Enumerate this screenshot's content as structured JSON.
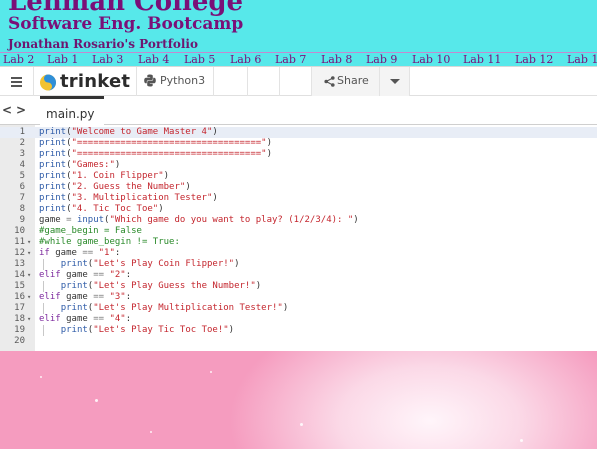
{
  "header": {
    "college": "Lehman College",
    "course": "Software Eng. Bootcamp",
    "portfolio": "Jonathan Rosario's Portfolio"
  },
  "nav": {
    "links": [
      "Lab 2",
      "Lab 1",
      "Lab 3",
      "Lab 4",
      "Lab 5",
      "Lab 6",
      "Lab 7",
      "Lab 8",
      "Lab 9",
      "Lab 10",
      "Lab 11",
      "Lab 12",
      "Lab 1"
    ]
  },
  "trinket": {
    "brand": "trinket",
    "language": "Python3",
    "share_label": "Share",
    "file_tab": "main.py",
    "nav_prev": "<",
    "nav_next": ">"
  },
  "code": {
    "lines": [
      "print(\"Welcome to Game Master 4\")",
      "print(\"==================================\")",
      "print(\"==================================\")",
      "print(\"Games:\")",
      "print(\"1. Coin Flipper\")",
      "print(\"2. Guess the Number\")",
      "print(\"3. Multiplication Tester\")",
      "print(\"4. Tic Toc Toe\")",
      "game = input(\"Which game do you want to play? (1/2/3/4): \")",
      "#game_begin = False",
      "#while game_begin != True:",
      "if game == \"1\":",
      "    print(\"Let's Play Coin Flipper!\")",
      "elif game == \"2\":",
      "    print(\"Let's Play Guess the Number!\")",
      "elif game == \"3\":",
      "    print(\"Let's Play Multiplication Tester!\")",
      "elif game == \"4\":",
      "    print(\"Let's Play Tic Toc Toe!\")",
      ""
    ],
    "fold_lines": [
      11,
      12,
      14,
      16,
      18
    ],
    "active_line": 1
  },
  "colors": {
    "header_bg": "#57e8ea",
    "header_text": "#7a1078",
    "decoration_pink": "#f59cbf"
  },
  "icons": {
    "menu": "hamburger-icon",
    "brand": "trinket-logo-icon",
    "language": "python-icon",
    "share": "share-icon",
    "dropdown": "caret-down-icon"
  }
}
